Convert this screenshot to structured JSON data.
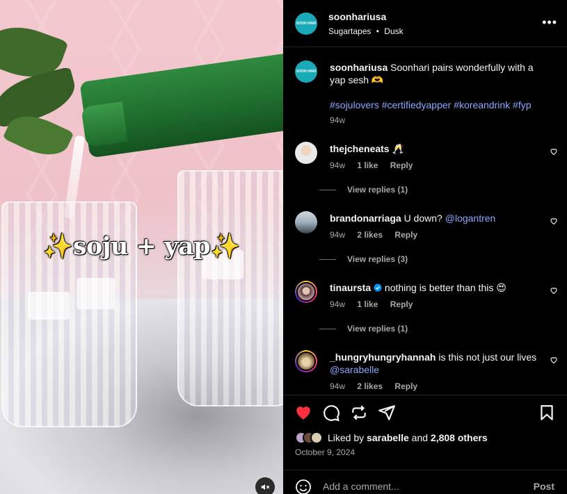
{
  "post": {
    "username": "soonhariusa",
    "audio": "Sugartapes",
    "audio_sep": "•",
    "audio_track": "Dusk",
    "avatar_text": "SOON HARI",
    "caption_overlay": "✨soju + yap✨",
    "more_label": "•••"
  },
  "description": {
    "username": "soonhariusa",
    "text": " Soonhari pairs wonderfully with a yap sesh 🫶",
    "hashtags": "#sojulovers #certifiedyapper #koreandrink #fyp",
    "time": "94w"
  },
  "comments": [
    {
      "username": "thejcheneats",
      "text": " 🥂",
      "mention": "",
      "time": "94w",
      "likes": "1 like",
      "reply": "Reply",
      "view_replies": "View replies (1)",
      "avatar_color": "#d9d9d9"
    },
    {
      "username": "brandonarriaga",
      "text": " U down? ",
      "mention": "@logantren",
      "time": "94w",
      "likes": "2 likes",
      "reply": "Reply",
      "view_replies": "View replies (3)",
      "avatar_color": "#6b7f8f"
    },
    {
      "username": "tinaursta",
      "text": " nothing is better than this 😍",
      "mention": "",
      "time": "94w",
      "likes": "1 like",
      "reply": "Reply",
      "view_replies": "View replies (1)",
      "avatar_color": "#b88",
      "verified": true
    },
    {
      "username": "_hungryhungryhannah",
      "text": " is this not just our lives ",
      "mention": "@sarabelle",
      "time": "94w",
      "likes": "2 likes",
      "reply": "Reply",
      "view_replies": "",
      "avatar_color": "#c9a96e"
    }
  ],
  "likes": {
    "prefix": "Liked by ",
    "user": "sarabelle",
    "mid": " and ",
    "count": "2,808 others"
  },
  "date": "October 9, 2024",
  "composer": {
    "placeholder": "Add a comment...",
    "post_label": "Post"
  },
  "colors": {
    "accent_like": "#ff3040",
    "link": "#8aa8ff",
    "brand": "#1aa9b7"
  },
  "icons": [
    "heart-icon",
    "comment-icon",
    "repost-icon",
    "share-icon",
    "bookmark-icon",
    "mute-icon",
    "emoji-icon",
    "verified-icon"
  ]
}
